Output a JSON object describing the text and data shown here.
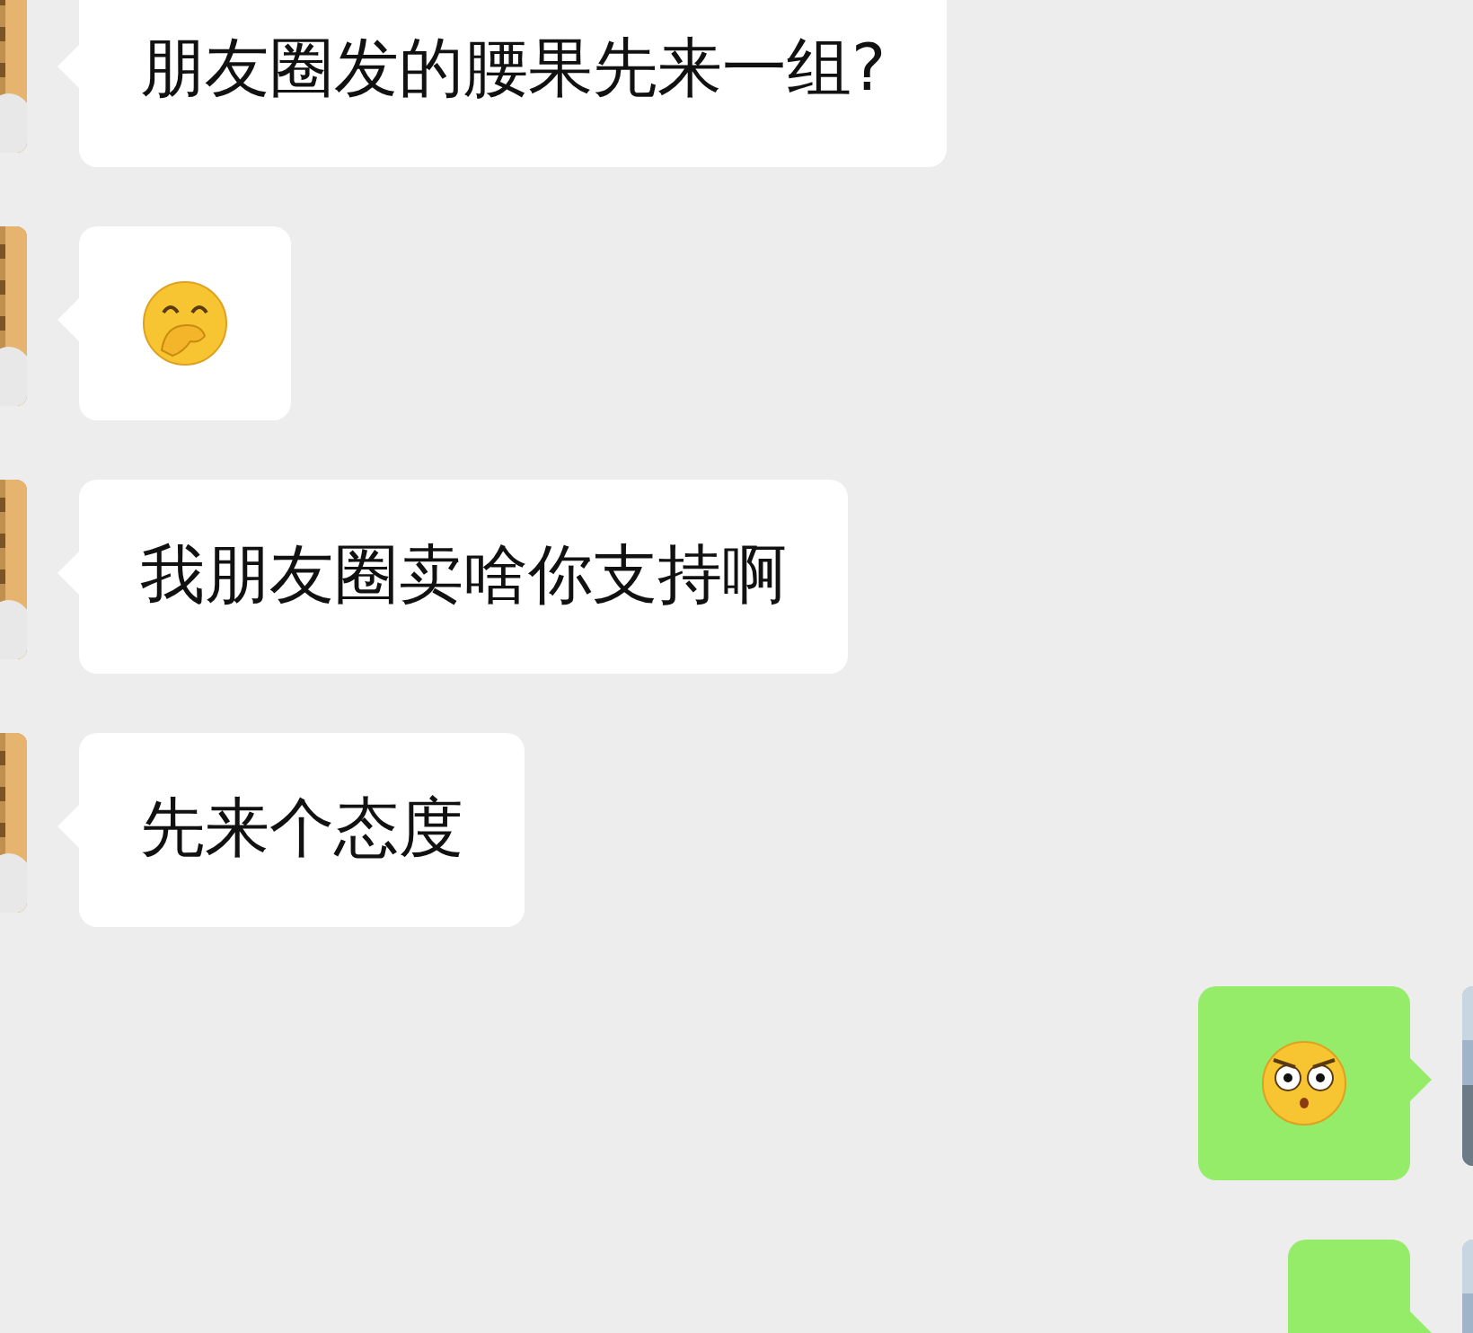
{
  "messages": [
    {
      "sent": false,
      "kind": "text",
      "text": "朋友圈发的腰果先来一组?"
    },
    {
      "sent": false,
      "kind": "giggle"
    },
    {
      "sent": false,
      "kind": "text",
      "text": "我朋友圈卖啥你支持啊"
    },
    {
      "sent": false,
      "kind": "text",
      "text": "先来个态度"
    },
    {
      "sent": true,
      "kind": "glare"
    },
    {
      "sent": true,
      "kind": "text"
    }
  ]
}
